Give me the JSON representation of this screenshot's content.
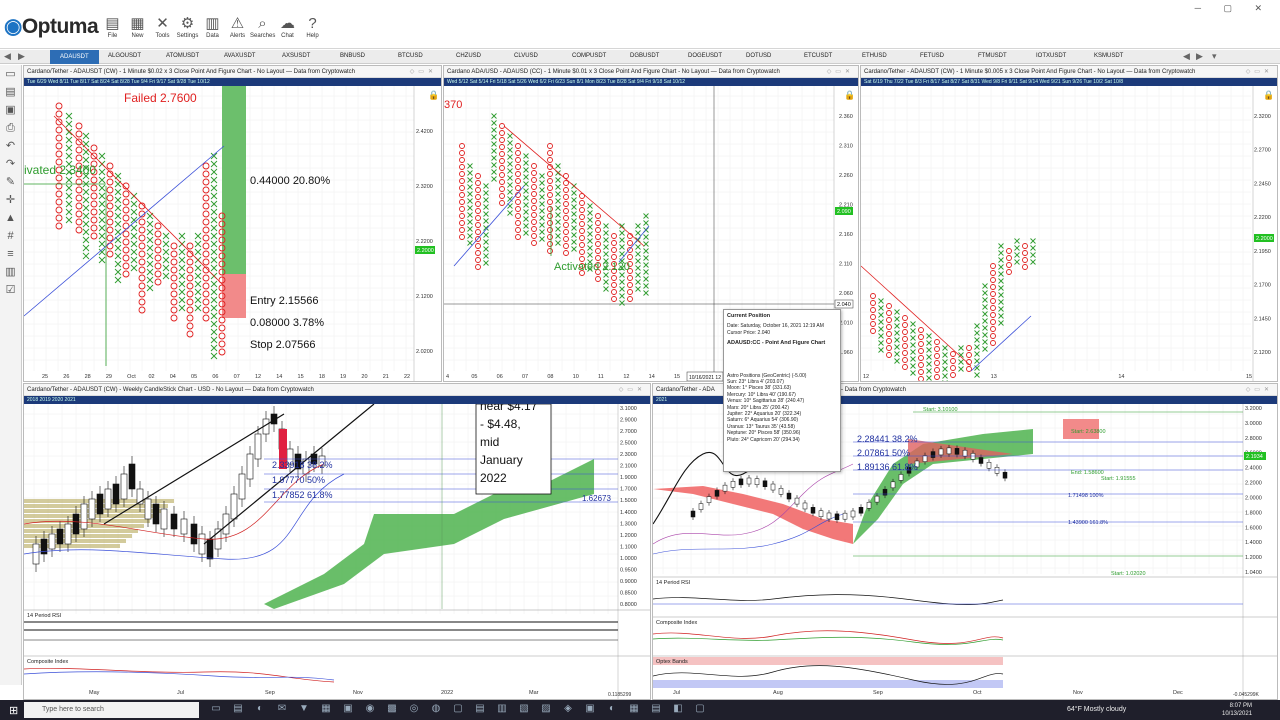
{
  "app": {
    "logo_text": "Optuma"
  },
  "toolbar": [
    {
      "label": "File",
      "icon": "folder-icon",
      "glyph": "▤"
    },
    {
      "label": "New",
      "icon": "chart-icon",
      "glyph": "▦"
    },
    {
      "label": "Tools",
      "icon": "tools-icon",
      "glyph": "✕"
    },
    {
      "label": "Settings",
      "icon": "gear-icon",
      "glyph": "⚙"
    },
    {
      "label": "Data",
      "icon": "data-icon",
      "glyph": "▥"
    },
    {
      "label": "Alerts",
      "icon": "alert-icon",
      "glyph": "⚠"
    },
    {
      "label": "Searches",
      "icon": "search-icon",
      "glyph": "⌕"
    },
    {
      "label": "Chat",
      "icon": "chat-icon",
      "glyph": "☁"
    },
    {
      "label": "Help",
      "icon": "help-icon",
      "glyph": "?"
    }
  ],
  "tabs": [
    "ADAUSDT",
    "ALGOUSDT",
    "ATOMUSDT",
    "AVAXUSDT",
    "AXSUSDT",
    "BNBUSD",
    "BTCUSD",
    "CHZUSD",
    "CLVUSD",
    "COMPUSDT",
    "DGBUSDT",
    "DOGEUSDT",
    "DOTUSD",
    "ETCUSDT",
    "ETHUSD",
    "FETUSD",
    "FTMUSDT",
    "IOTXUSDT",
    "KSMUSDT"
  ],
  "panels": {
    "p1": {
      "title": "Cardano/Tether - ADAUSDT (CW) - 1 Minute $0.02 x 3 Close Point And Figure Chart - No Layout — Data from Cryptowatch",
      "strip": "Tue 6/29   Wed 8/11   Tue 8/17   Sat 8/24   Sat 8/28   Tue 9/4   Fri 9/17   Sat 9/28   Tue 10/12",
      "failed": "Failed 2.7600",
      "activated": "ivated 2.3400",
      "range": "0.44000   20.80%",
      "entry": "Entry  2.15566",
      "risk": "0.08000   3.78%",
      "stop": "Stop  2.07566",
      "price_badge": "2.2000",
      "yticks": [
        "2.4200",
        "2.3200",
        "2.2200",
        "2.1200",
        "2.0200"
      ],
      "xticks": [
        "25",
        "26",
        "28",
        "29",
        "Oct",
        "02",
        "04",
        "05",
        "06",
        "07",
        "12",
        "14",
        "15",
        "18",
        "19",
        "20",
        "21",
        "22"
      ]
    },
    "p2": {
      "title": "Cardano ADA/USD - ADAUSD (CC) - 1 Minute $0.01 x 3 Close Point And Figure Chart - No Layout — Data from Cryptowatch",
      "strip": "Wed 5/12   Sat 5/14   Fri 5/18   Sat 5/26   Wed 6/2   Fri 6/23   Sun 8/1   Mon 8/23   Tue 8/28   Sat 9/4   Fri 9/18   Sat 10/12",
      "top_label": "370",
      "activated": "Activated 2.120",
      "price_badge": "2.090",
      "cursor_badge": "2.040",
      "date_badge": "10/16/2021 12",
      "yticks": [
        "2.360",
        "2.310",
        "2.260",
        "2.210",
        "2.160",
        "2.110",
        "2.060",
        "2.010",
        "1.960"
      ],
      "xticks": [
        "4",
        "05",
        "06",
        "07",
        "08",
        "10",
        "11",
        "12",
        "14",
        "15"
      ]
    },
    "p3": {
      "title": "Cardano/Tether - ADAUSDT (CW) - 1 Minute $0.005 x 3 Close Point And Figure Chart - No Layout — Data from Cryptowatch",
      "strip": "Sat 6/19   Thu 7/22   Tue 8/3   Fri 8/17   Sat 8/27   Sat 8/31   Wed 9/8   Fri 9/11   Sat 9/14   Wed 9/21   Sun 9/26   Tue 10/2   Sat 10/8",
      "price_badge": "2.2000",
      "yticks": [
        "2.3200",
        "2.2700",
        "2.2450",
        "2.2200",
        "2.1950",
        "2.1700",
        "2.1450",
        "2.1200"
      ],
      "xticks": [
        "12",
        "13",
        "14",
        "15"
      ]
    },
    "p4": {
      "title": "Cardano/Tether - ADAUSDT (CW) - Weekly CandleStick Chart - USD - No Layout — Data from Cryptowatch",
      "strip": "2018   2019   2020   2021",
      "box": [
        "near $4.17",
        "- $4.48,",
        "mid",
        "January",
        "2022"
      ],
      "fib1": "2.33918   38.2%",
      "fib2": "1.97770   50%",
      "fib3": "1.77852   61.8%",
      "fib_right": "1.62673",
      "rsi_label": "14 Period RSI",
      "ci_label": "Composite Index",
      "yticks": [
        "3.1000",
        "2.9000",
        "2.7000",
        "2.5000",
        "2.3000",
        "2.1000",
        "1.9000",
        "1.7000",
        "1.5000",
        "1.4000",
        "1.3000",
        "1.2000",
        "1.1000",
        "1.0000",
        "0.9500",
        "0.9000",
        "0.8500",
        "0.8000"
      ],
      "xticks": [
        "May",
        "Jul",
        "Sep",
        "Nov",
        "2022",
        "Mar"
      ],
      "bottom_badge": "0.1185299"
    },
    "p5": {
      "title": "Cardano/Tether - ADA",
      "title2": "— Data from Cryptowatch",
      "strip": "2021",
      "fib1": "2.28441   38.2%",
      "fib2": "2.07861   50%",
      "fib3": "1.89136   61.8%",
      "lvl_a": "1.71498   100%",
      "lvl_b": "1.43900   161.8%",
      "start_a": "Start: 2.63800",
      "start_b": "Start: 1.02020",
      "end_a": "End: 1.58600",
      "start_c": "Start: 1.91555",
      "top_lbl": "Start: 3.10100",
      "rsi_label": "14 Period RSI",
      "ci_label": "Composite Index",
      "ob_label": "Optex Bands",
      "yticks": [
        "3.2000",
        "3.0000",
        "2.8000",
        "2.6000",
        "2.4000",
        "2.2000",
        "2.0000",
        "1.8000",
        "1.6000",
        "1.4000",
        "1.2000",
        "1.0400"
      ],
      "xticks": [
        "Jul",
        "Aug",
        "Sep",
        "Oct",
        "Nov",
        "Dec"
      ],
      "price_badge": "2.1934",
      "bottom_badge": "-0.045299K"
    }
  },
  "tooltip": {
    "title": "Current Position",
    "date": "Date: Saturday, October 16, 2021 12:19 AM",
    "cursor": "Cursor Price: 2.040",
    "chart": "ADAUSD:CC - Point And Figure Chart",
    "astro_title": "Astro Positions (GeoCentric) (-5.00)",
    "rows": [
      "Sun: 23° Libra 4' (203.07)",
      "Moon: 1° Pisces 38' (331.63)",
      "Mercury: 10° Libra 40' (190.67)",
      "Venus: 10° Sagittarius 28' (240.47)",
      "Mars: 20° Libra 25' (200.42)",
      "Jupiter: 22° Aquarius 20' (322.34)",
      "Saturn: 6° Aquarius 54' (306.90)",
      "Uranus: 13° Taurus 35' (43.58)",
      "Neptune: 20° Pisces 58' (350.96)",
      "Pluto: 24° Capricorn 20' (294.34)"
    ]
  },
  "taskbar": {
    "search_placeholder": "Type here to search",
    "weather": "64°F  Mostly cloudy",
    "time": "8:07 PM",
    "date": "10/13/2021"
  },
  "colors": {
    "accent": "#2d6db5",
    "bull": "#2e9c2e",
    "bear": "#e02020",
    "cloud_green": "#4fb34f",
    "cloud_red": "#f06060"
  }
}
